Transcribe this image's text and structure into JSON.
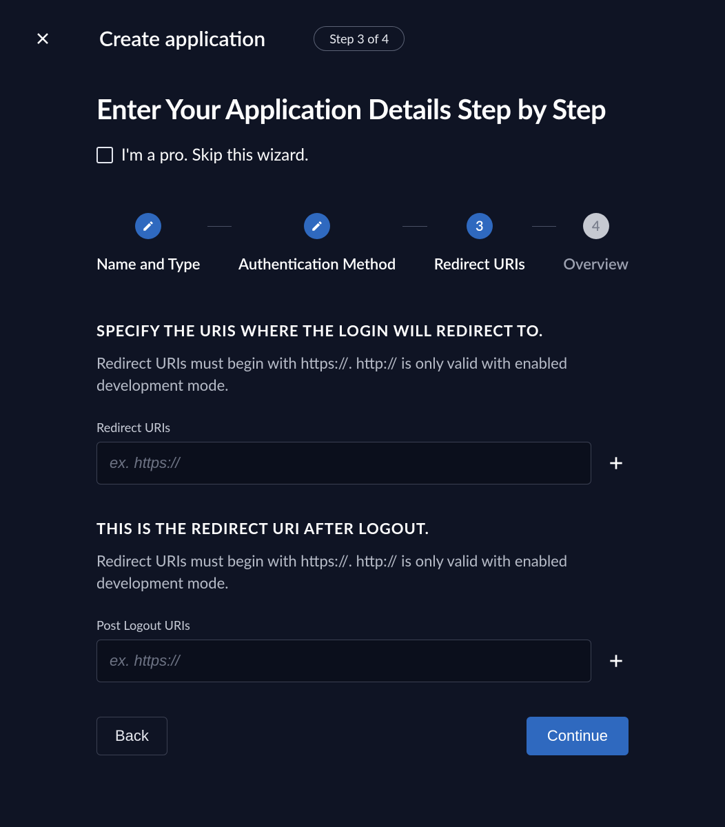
{
  "header": {
    "title": "Create application",
    "step_badge": "Step 3 of 4"
  },
  "page_title": "Enter Your Application Details Step by Step",
  "skip": {
    "label": "I'm a pro. Skip this wizard.",
    "checked": false
  },
  "stepper": {
    "steps": [
      {
        "label": "Name and Type",
        "state": "done"
      },
      {
        "label": "Authentication Method",
        "state": "done"
      },
      {
        "label": "Redirect URIs",
        "state": "active",
        "number": "3"
      },
      {
        "label": "Overview",
        "state": "pending",
        "number": "4"
      }
    ]
  },
  "redirect_section": {
    "title": "SPECIFY THE URIS WHERE THE LOGIN WILL REDIRECT TO.",
    "description": "Redirect URIs must begin with https://. http:// is only valid with enabled development mode.",
    "field_label": "Redirect URIs",
    "placeholder": "ex. https://",
    "value": ""
  },
  "logout_section": {
    "title": "THIS IS THE REDIRECT URI AFTER LOGOUT.",
    "description": "Redirect URIs must begin with https://. http:// is only valid with enabled development mode.",
    "field_label": "Post Logout URIs",
    "placeholder": "ex. https://",
    "value": ""
  },
  "footer": {
    "back": "Back",
    "continue": "Continue"
  }
}
